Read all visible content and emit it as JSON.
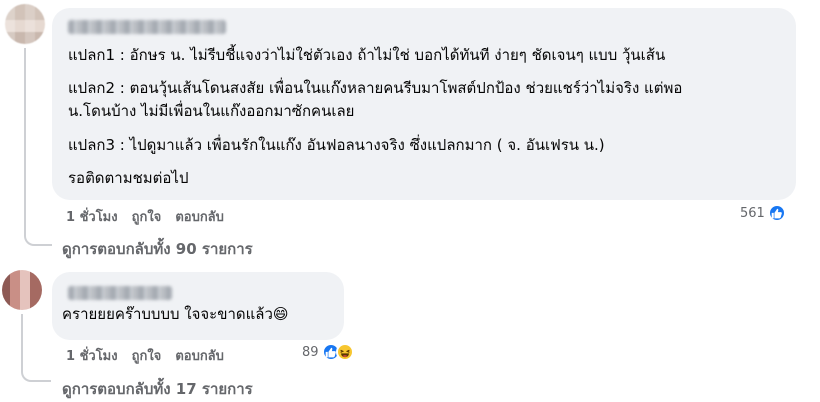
{
  "comments": [
    {
      "lines": [
        "แปลก1 : อักษร น. ไม่รีบชี้แจงว่าไม่ใช่ตัวเอง ถ้าไม่ใช่ บอกได้ทันที ง่ายๆ ชัดเจนๆ แบบ วุ้นเส้น",
        "แปลก2 : ตอนวุ้นเส้นโดนสงสัย เพื่อนในแก๊งหลายคนรีบมาโพสต์ปกป้อง ช่วยแชร์ว่าไม่จริง แต่พอ",
        "น.โดนบ้าง ไม่มีเพื่อนในแก๊งออกมาซักคนเลย",
        "แปลก3 : ไปดูมาแล้ว เพื่อนรักในแก๊ง อันฟอลนางจริง ซึ่งแปลกมาก ( จ. อันเฟรน น.)",
        "รอติดตามชมต่อไป"
      ],
      "time": "1 ชั่วโมง",
      "like_label": "ถูกใจ",
      "reply_label": "ตอบกลับ",
      "reaction_count": "561",
      "reaction_icons": [
        "like-icon"
      ],
      "view_replies": "ดูการตอบกลับทั้ง 90 รายการ"
    },
    {
      "lines": [
        "ครายยยคร๊าบบบบ ใจจะขาดแล้ว😄"
      ],
      "time": "1 ชั่วโมง",
      "like_label": "ถูกใจ",
      "reply_label": "ตอบกลับ",
      "reaction_count": "89",
      "reaction_icons": [
        "like-icon",
        "haha-icon"
      ],
      "view_replies": "ดูการตอบกลับทั้ง 17 รายการ"
    }
  ],
  "colors": {
    "bubble": "#f0f2f5",
    "like_blue": "#1877f2",
    "haha_yellow": "#f7c62f",
    "secondary_text": "#65676b"
  }
}
